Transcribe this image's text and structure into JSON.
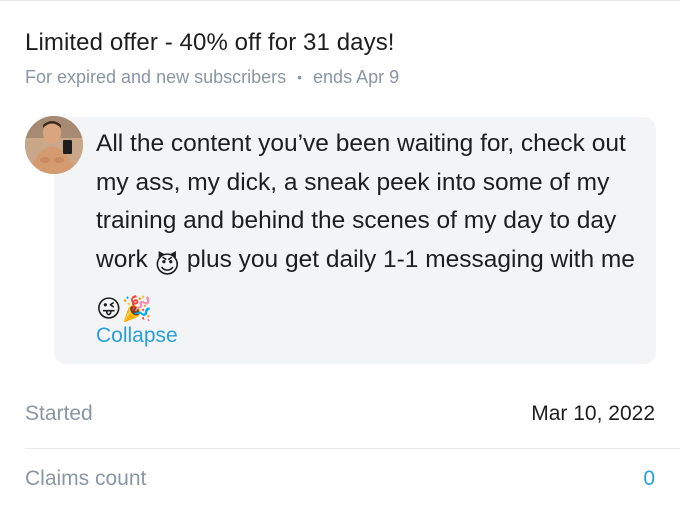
{
  "offer": {
    "title": "Limited offer - 40% off for 31 days!",
    "audience": "For expired and new subscribers",
    "separator": "•",
    "ends": "ends Apr 9"
  },
  "message": {
    "avatar_icon": "profile-photo",
    "text_part1": "All the content you’ve been waiting for, check out my ass, my dick, a sneak peek into some of my training and behind the scenes of my day to day work ",
    "emoji1": "😈",
    "text_part2": " plus you get daily 1-1 messaging with me ",
    "emoji2": "😜",
    "emoji3": "🎉",
    "collapse_label": "Collapse"
  },
  "details": {
    "started_label": "Started",
    "started_value": "Mar 10, 2022",
    "claims_label": "Claims count",
    "claims_value": "0"
  },
  "colors": {
    "muted_text": "#8a96a3",
    "link": "#2aa0d8",
    "bubble_bg": "#f3f4f6",
    "divider": "#e6e8eb"
  }
}
